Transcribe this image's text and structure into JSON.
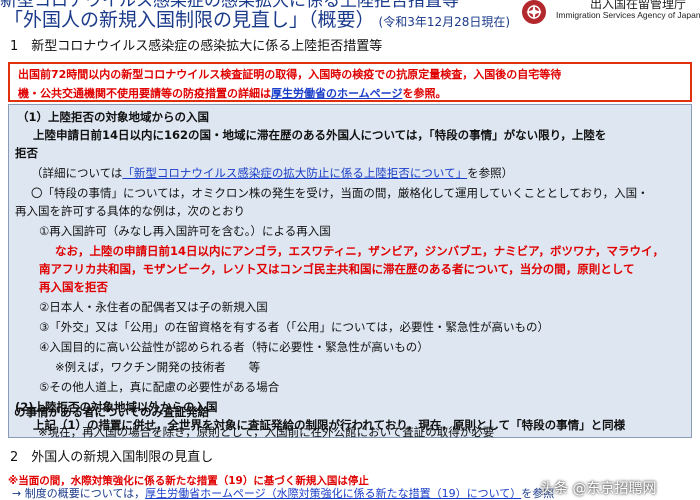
{
  "header": {
    "top_line": "新型コロナウイルス感染症の感染拡大に係る上陸拒否措置等",
    "title": "「外国人の新規入国制限の見直し」（概要）",
    "date": "(令和3年12月28日現在)",
    "agency_jp": "出入国在留管理庁",
    "agency_en": "Immigration Services Agency of Japan"
  },
  "section1": {
    "heading": "1　新型コロナウイルス感染症の感染拡大に係る上陸拒否措置等"
  },
  "redbox": {
    "line1": "出国前72時間以内の新型コロナウイルス検査証明の取得，入国時の検疫での抗原定量検査，入国後の自宅等待",
    "line2_pre": "機・公共交通機関不使用要請等の防疫措置の詳細は",
    "line2_link": "厚生労働省のホームページ",
    "line2_post": "を参照。"
  },
  "main": {
    "l1": "（1）上陸拒否の対象地域からの入国",
    "l2": "上陸申請日前14日以内に162の国・地域に滞在歴のある外国人については，「特段の事情」がない限り，上陸を",
    "l3": "拒否",
    "l4_pre": "（詳細については",
    "l4_link": "「新型コロナウイルス感染症の拡大防止に係る上陸拒否について」",
    "l4_post": "を参照）",
    "l5": "〇「特段の事情」については，オミクロン株の発生を受け，当面の間，厳格化して運用していくこととしており，入国・",
    "l6": "再入国を許可する具体的な例は，次のとおり",
    "l7": "①再入国許可（みなし再入国許可を含む。）による再入国",
    "l8": "なお，上陸の申請日前14日以内にアンゴラ，エスワティニ，ザンビア，ジンバブエ，ナミビア，ボツワナ，マラウイ，",
    "l9": "南アフリカ共和国，モザンビーク，レソト又はコンゴ民主共和国に滞在歴のある者について，当分の間，原則として",
    "l10": "再入国を拒否",
    "l11": "②日本人・永住者の配偶者又は子の新規入国",
    "l12": "③「外交」又は「公用」の在留資格を有する者（「公用」については，必要性・緊急性が高いもの）",
    "l13": "④入国目的に高い公益性が認められる者（特に必要性・緊急性が高いもの）",
    "l14": "※例えば，ワクチン開発の技術者　　等",
    "l15": "⑤その他人道上，真に配慮の必要性がある場合",
    "l16": "(2)上陸拒否の対象地域以外からの入国",
    "l17": "上記（1）の措置に併せ，全世界を対象に査証発給の制限が行われており，現在，原則として「特段の事情」と同様",
    "l18": "の事情がある者についてのみ査証発給",
    "l19": "※現在，再入国の場合を除き，原則として，入国前に在外公館において査証の取得が必要"
  },
  "section2": {
    "heading": "2　外国人の新規入国制限の見直し"
  },
  "bottom": {
    "note": "※当面の間，水際対策強化に係る新たな措置（19）に基づく新規入国は停止",
    "arrow_pre": "→ 制度の概要については，",
    "arrow_link": "厚生労働省ホームページ（水際対策強化に係る新たな措置（19）について）",
    "arrow_post": "を参照"
  },
  "watermark": "头条 @东京招聘网"
}
